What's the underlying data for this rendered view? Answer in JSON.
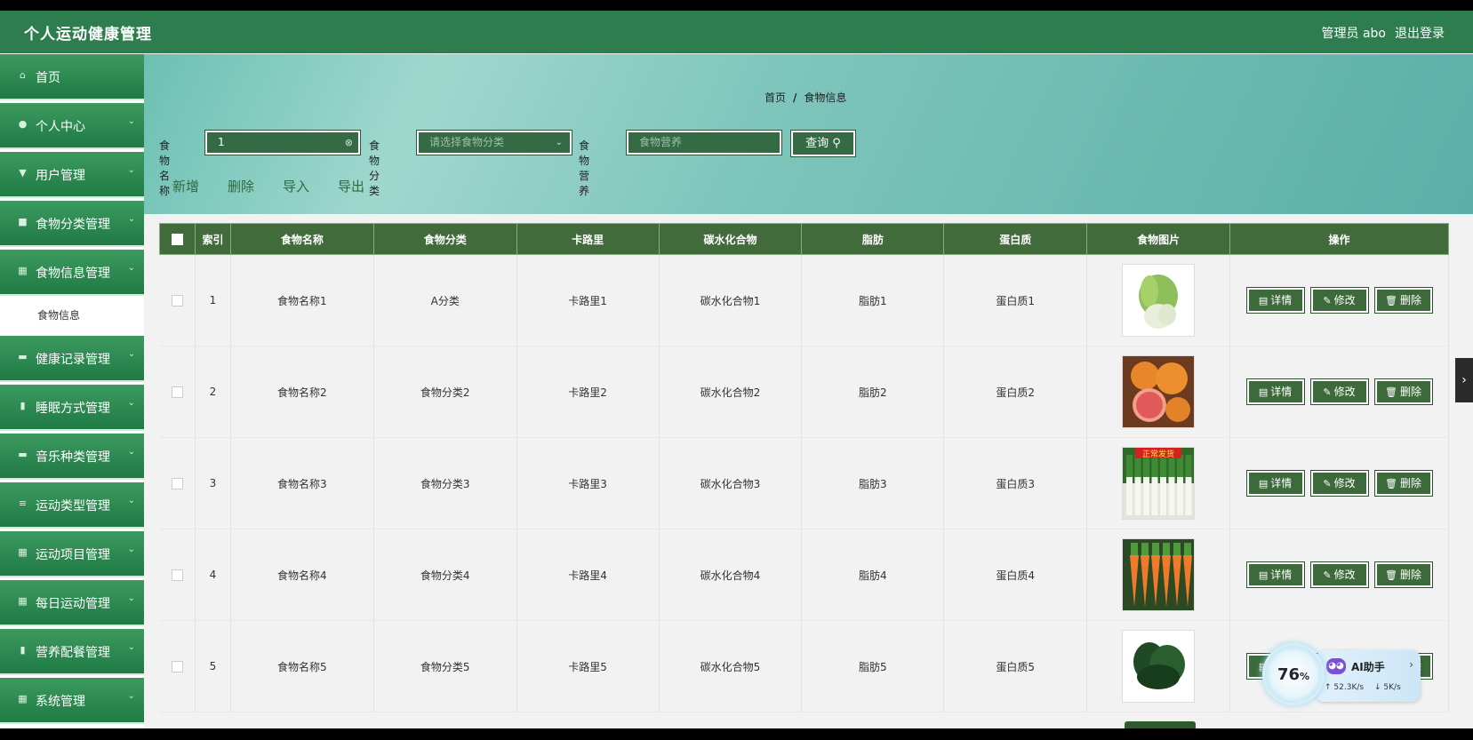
{
  "app": {
    "title": "个人运动健康管理",
    "admin_label": "管理员 abo",
    "logout_label": "退出登录"
  },
  "sidebar": {
    "items": [
      {
        "label": "首页",
        "icon": "home-icon",
        "glyph": "⌂",
        "arrow": false
      },
      {
        "label": "个人中心",
        "icon": "user-icon",
        "glyph": "●",
        "arrow": true
      },
      {
        "label": "用户管理",
        "icon": "users-icon",
        "glyph": "▼",
        "arrow": true
      },
      {
        "label": "食物分类管理",
        "icon": "category-icon",
        "glyph": "■",
        "arrow": true
      },
      {
        "label": "食物信息管理",
        "icon": "grid-icon",
        "glyph": "▦",
        "arrow": true
      }
    ],
    "sub_items": [
      {
        "label": "食物信息"
      }
    ],
    "items_after": [
      {
        "label": "健康记录管理",
        "icon": "record-icon",
        "glyph": "▬",
        "arrow": true
      },
      {
        "label": "睡眠方式管理",
        "icon": "sleep-icon",
        "glyph": "▮",
        "arrow": true
      },
      {
        "label": "音乐种类管理",
        "icon": "music-icon",
        "glyph": "▬",
        "arrow": true
      },
      {
        "label": "运动类型管理",
        "icon": "list-icon",
        "glyph": "≡",
        "arrow": true
      },
      {
        "label": "运动项目管理",
        "icon": "grid-icon",
        "glyph": "▦",
        "arrow": true
      },
      {
        "label": "每日运动管理",
        "icon": "grid-icon",
        "glyph": "▦",
        "arrow": true
      },
      {
        "label": "营养配餐管理",
        "icon": "meal-icon",
        "glyph": "▮",
        "arrow": true
      },
      {
        "label": "系统管理",
        "icon": "grid-icon",
        "glyph": "▦",
        "arrow": true
      }
    ]
  },
  "breadcrumb": {
    "home": "首页",
    "sep": "/",
    "current": "食物信息"
  },
  "search": {
    "name_label": "食物名称",
    "name_value": "1",
    "category_label": "食物分类",
    "category_placeholder": "请选择食物分类",
    "nutrition_label": "食物营养",
    "nutrition_placeholder": "食物营养",
    "query_label": "查询 ⚲"
  },
  "actions": {
    "add": "新增",
    "delete": "删除",
    "import": "导入",
    "export": "导出"
  },
  "table": {
    "headers": [
      "索引",
      "食物名称",
      "食物分类",
      "卡路里",
      "碳水化合物",
      "脂肪",
      "蛋白质",
      "食物图片",
      "操作"
    ],
    "rows": [
      {
        "index": "1",
        "name": "食物名称1",
        "category": "A分类",
        "calories": "卡路里1",
        "carbs": "碳水化合物1",
        "fat": "脂肪1",
        "protein": "蛋白质1",
        "image": "bok-choy-image"
      },
      {
        "index": "2",
        "name": "食物名称2",
        "category": "食物分类2",
        "calories": "卡路里2",
        "carbs": "碳水化合物2",
        "fat": "脂肪2",
        "protein": "蛋白质2",
        "image": "grapefruit-image"
      },
      {
        "index": "3",
        "name": "食物名称3",
        "category": "食物分类3",
        "calories": "卡路里3",
        "carbs": "碳水化合物3",
        "fat": "脂肪3",
        "protein": "蛋白质3",
        "image": "leek-image",
        "image_badge": "正常发货"
      },
      {
        "index": "4",
        "name": "食物名称4",
        "category": "食物分类4",
        "calories": "卡路里4",
        "carbs": "碳水化合物4",
        "fat": "脂肪4",
        "protein": "蛋白质4",
        "image": "carrot-image"
      },
      {
        "index": "5",
        "name": "食物名称5",
        "category": "食物分类5",
        "calories": "卡路里5",
        "carbs": "碳水化合物5",
        "fat": "脂肪5",
        "protein": "蛋白质5",
        "image": "spinach-image"
      }
    ],
    "op_detail": "详情",
    "op_edit": "修改",
    "op_delete": "删除"
  },
  "ai_widget": {
    "percent": "76",
    "percent_unit": "%",
    "label": "AI助手",
    "upload": "52.3K/s",
    "download": "5K/s"
  },
  "colors": {
    "header": "#2e7d4f",
    "table_header": "#426b3c",
    "button": "#3c6a3a",
    "sidebar_gradient_top": "#3c9a5f",
    "sidebar_gradient_bottom": "#1f7a44"
  }
}
